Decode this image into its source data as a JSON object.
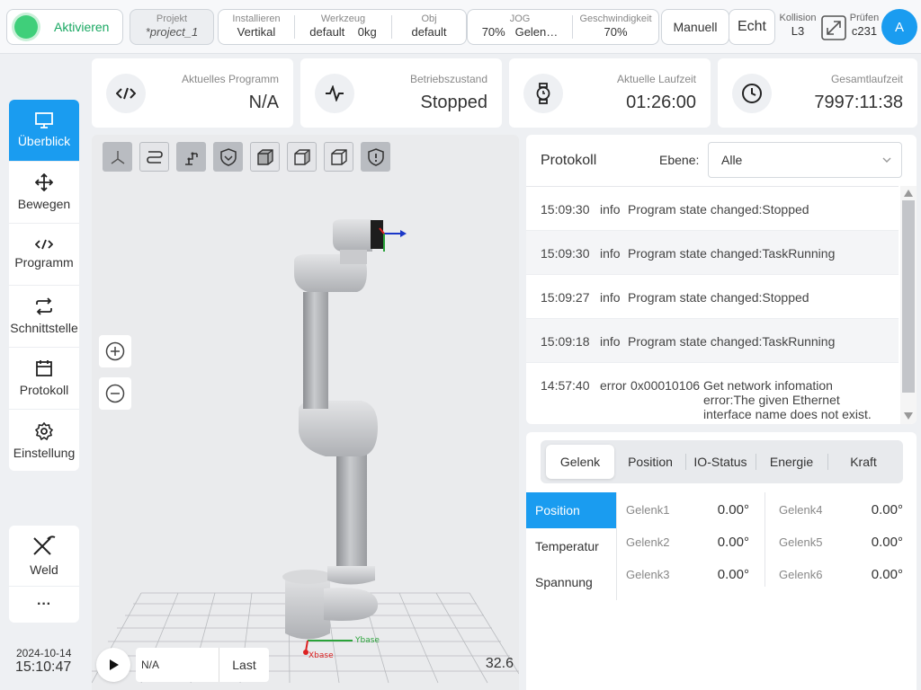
{
  "topbar": {
    "activate_label": "Aktivieren",
    "project": {
      "key": "Projekt",
      "value": "*project_1"
    },
    "install": {
      "key": "Installieren",
      "value": "Vertikal"
    },
    "tool": {
      "key": "Werkzeug",
      "value1": "default",
      "value2": "0kg"
    },
    "obj": {
      "key": "Obj",
      "value": "default"
    },
    "jog": {
      "key": "JOG",
      "value1": "70%",
      "value2": "Gelen…"
    },
    "speed": {
      "key": "Geschwindigkeit",
      "value": "70%"
    },
    "mode_label": "Manuell",
    "real_label": "Echt",
    "collision": {
      "key": "Kollision",
      "value": "L3"
    },
    "check": {
      "key": "Prüfen",
      "value": "c231"
    },
    "avatar": "A",
    "activate_color": "#19a862"
  },
  "cards": [
    {
      "key": "Aktuelles Programm",
      "value": "N/A",
      "icon": "code-icon"
    },
    {
      "key": "Betriebszustand",
      "value": "Stopped",
      "icon": "pulse-icon"
    },
    {
      "key": "Aktuelle Laufzeit",
      "value": "01:26:00",
      "icon": "watch-icon"
    },
    {
      "key": "Gesamtlaufzeit",
      "value": "7997:11:38",
      "icon": "clock-icon"
    }
  ],
  "sidebar": {
    "items": [
      {
        "label": "Überblick",
        "icon": "monitor-icon",
        "active": true
      },
      {
        "label": "Bewegen",
        "icon": "move-icon"
      },
      {
        "label": "Programm",
        "icon": "code-icon"
      },
      {
        "label": "Schnittstelle",
        "icon": "swap-icon"
      },
      {
        "label": "Protokoll",
        "icon": "calendar-icon"
      },
      {
        "label": "Einstellung",
        "icon": "gear-icon"
      }
    ],
    "plugin": {
      "label": "Weld",
      "icon": "weld-icon"
    },
    "more": "···",
    "accent": "#1a9cf0"
  },
  "datetime": {
    "date": "2024-10-14",
    "time": "15:10:47"
  },
  "viewport": {
    "program": "N/A",
    "last_label": "Last",
    "fps": "32.6",
    "axis_x": "Xbase",
    "axis_y": "Ybase"
  },
  "protokoll": {
    "title": "Protokoll",
    "level_label": "Ebene:",
    "level_value": "Alle",
    "rows": [
      {
        "time": "15:09:30",
        "level": "info",
        "msg": "Program state changed:Stopped"
      },
      {
        "time": "15:09:30",
        "level": "info",
        "msg": "Program state changed:TaskRunning"
      },
      {
        "time": "15:09:27",
        "level": "info",
        "msg": "Program state changed:Stopped"
      },
      {
        "time": "15:09:18",
        "level": "info",
        "msg": "Program state changed:TaskRunning"
      },
      {
        "time": "14:57:40",
        "level": "error",
        "code": "0x00010106",
        "msg": "Get network infomation error:The given Ethernet interface name does not exist. (sr…"
      }
    ]
  },
  "joint_panel": {
    "tabs": [
      "Gelenk",
      "Position",
      "IO-Status",
      "Energie",
      "Kraft"
    ],
    "subnav": [
      "Position",
      "Temperatur",
      "Spannung"
    ],
    "joints": [
      {
        "name": "Gelenk1",
        "value": "0.00°"
      },
      {
        "name": "Gelenk2",
        "value": "0.00°"
      },
      {
        "name": "Gelenk3",
        "value": "0.00°"
      },
      {
        "name": "Gelenk4",
        "value": "0.00°"
      },
      {
        "name": "Gelenk5",
        "value": "0.00°"
      },
      {
        "name": "Gelenk6",
        "value": "0.00°"
      }
    ]
  }
}
